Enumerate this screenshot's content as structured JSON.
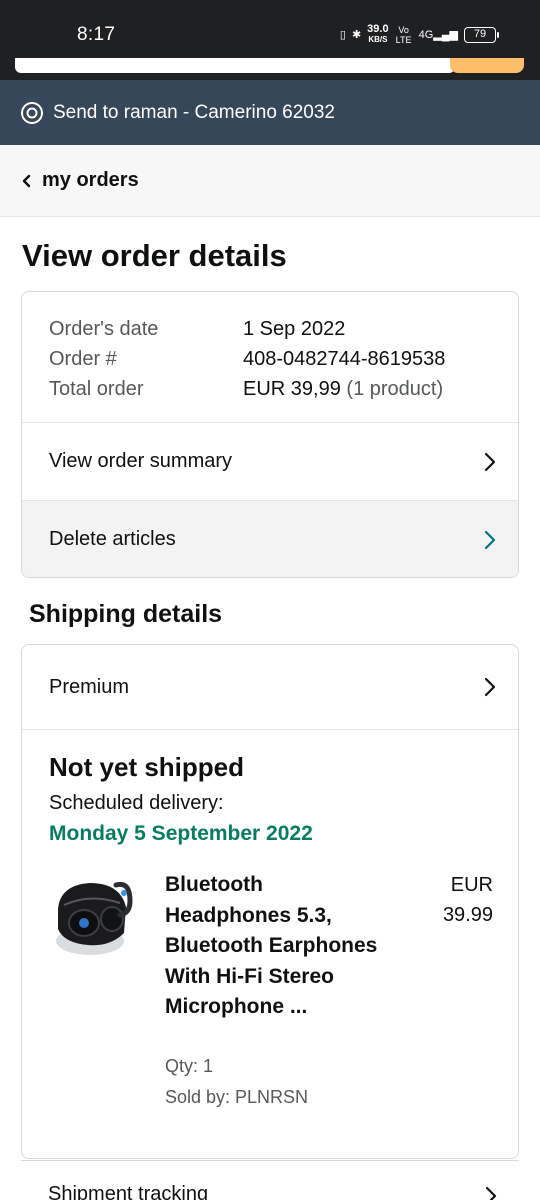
{
  "status_bar": {
    "time": "8:17",
    "speed_value": "39.0",
    "speed_unit": "KB/S",
    "network": "Vo LTE",
    "signal": "4G",
    "battery": "79"
  },
  "location": {
    "text": "Send to raman - Camerino 62032",
    "icon": "location-pin-icon"
  },
  "breadcrumb": {
    "label": "my orders",
    "icon": "chevron-left-icon"
  },
  "page_title": "View order details",
  "order": {
    "date_label": "Order's date",
    "date_value": "1 Sep 2022",
    "number_label": "Order #",
    "number_value": "408-0482744-8619538",
    "total_label": "Total order",
    "total_value": "EUR 39,99",
    "total_count": "(1 product)"
  },
  "actions": {
    "view_summary": "View order summary",
    "delete_articles": "Delete articles"
  },
  "shipping": {
    "section_title": "Shipping details",
    "speed": "Premium",
    "status": "Not yet shipped",
    "scheduled_label": "Scheduled delivery:",
    "scheduled_date": "Monday 5 September 2022",
    "tracking_label": "Shipment tracking"
  },
  "product": {
    "name": "Bluetooth Headphones 5.3, Bluetooth Earphones With Hi-Fi Stereo Microphone ...",
    "currency": "EUR",
    "price": "39.99",
    "qty": "Qty: 1",
    "seller": "Sold by: PLNRSN",
    "image": "wireless-earbuds-image"
  },
  "colors": {
    "status_bar": "#1f2022",
    "location_bar": "#37475a",
    "delivery_green": "#067d62",
    "accent_teal": "#007185",
    "search_button": "#febd69"
  }
}
